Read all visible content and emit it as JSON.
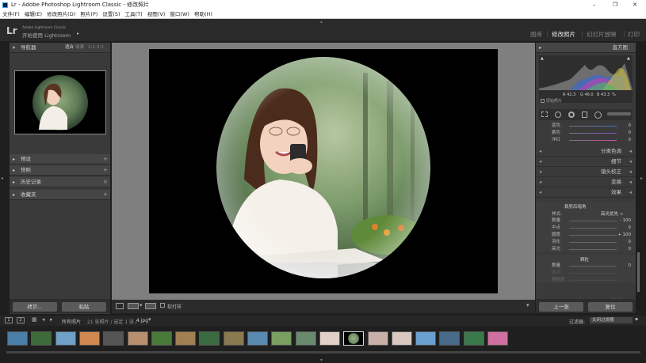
{
  "window": {
    "title": "Lr - Adobe Photoshop Lightroom Classic - 修改照片",
    "controls": [
      "–",
      "❐",
      "✕"
    ]
  },
  "menu": [
    "文件(F)",
    "编辑(E)",
    "修改照片(D)",
    "照片(P)",
    "设置(S)",
    "工具(T)",
    "视图(V)",
    "窗口(W)",
    "帮助(H)"
  ],
  "identity": {
    "logo": "Lr",
    "line1": "Adobe Lightroom Classic",
    "line2": "开始使用 Lightroom"
  },
  "modules": [
    "图库",
    "修改照片",
    "幻灯片放映",
    "打印"
  ],
  "active_module": "修改照片",
  "left": {
    "navigator": {
      "title": "导航器",
      "zoom_options": [
        "适合",
        "填满",
        "1:1",
        "3:1"
      ]
    },
    "panels": [
      "预设",
      "快照",
      "历史记录",
      "收藏夹"
    ],
    "copy_button": "拷贝...",
    "paste_button": "粘贴"
  },
  "toolbar": {
    "softproof": "软打样"
  },
  "right": {
    "histogram_title": "直方图",
    "histogram_readout": [
      "R  42.3",
      "G  46.0",
      "B  43.3",
      "%"
    ],
    "original_photo": "原始照片",
    "hsl_sliders": [
      {
        "label": "蓝色",
        "value": "0"
      },
      {
        "label": "紫色",
        "value": "0"
      },
      {
        "label": "洋红",
        "value": "0"
      }
    ],
    "sections": [
      "分离色调",
      "细节",
      "镜头校正",
      "变换",
      "效果"
    ],
    "vignette": {
      "title": "裁剪后暗角",
      "style_label": "样式:",
      "style_value": "高光优先 ÷",
      "sliders": [
        {
          "label": "数量",
          "value": "- 100"
        },
        {
          "label": "中点",
          "value": "0"
        },
        {
          "label": "圆度",
          "value": "+ 100"
        },
        {
          "label": "羽化",
          "value": "0"
        },
        {
          "label": "高光",
          "value": "0"
        }
      ]
    },
    "grain": {
      "title": "颗粒",
      "sliders": [
        {
          "label": "数量",
          "value": "0"
        },
        {
          "label": "大小",
          "value": ""
        },
        {
          "label": "粗糙度",
          "value": ""
        }
      ]
    },
    "calibration": "校准",
    "prev_button": "上一张",
    "reset_button": "复位"
  },
  "filmstrip": {
    "source": "所有照片",
    "count": "21 张照片 / 选定 1 张 /",
    "filename": "4.jpg",
    "filter_label": "过滤器:",
    "filter_value": "关闭过滤器",
    "page_numbers": [
      "1",
      "2"
    ],
    "thumbnails": [
      "sea",
      "forest",
      "lake",
      "sunset",
      "rock",
      "portrait",
      "field",
      "mountain",
      "garden",
      "valley",
      "coast",
      "meadow",
      "road",
      "woman",
      "vignette-portrait",
      "woman2",
      "woman3",
      "beach",
      "ocean",
      "park",
      "flowers"
    ]
  },
  "colors": {
    "accent": "#e8e8e8",
    "panel": "#3a3a3a",
    "bg": "#1e1e1e"
  }
}
